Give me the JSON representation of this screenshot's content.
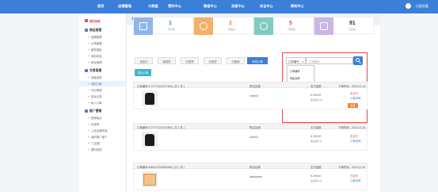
{
  "topnav": {
    "items": [
      "首页",
      "店铺管理",
      "大数据",
      "预约中心",
      "微信中心",
      "消息中心",
      "安全中心",
      "帮助中心"
    ],
    "user": "小甜欣喜"
  },
  "sidebar": {
    "home": "我的商城",
    "sections": [
      {
        "label": "商品管理",
        "items": [
          "品牌管理",
          "分类管理",
          "属性模板",
          "添加商品",
          "库存管理"
        ]
      },
      {
        "label": "交易管理",
        "items": [
          "佣金结算",
          "我的订单",
          "评价管理",
          "投诉记录",
          "私人订单"
        ]
      },
      {
        "label": "推广营销",
        "items": [
          "推荐组合",
          "优惠券",
          "入驻店铺商城",
          "我的推广客户",
          "广告推广",
          "限时抢购"
        ]
      }
    ]
  },
  "main": {
    "title": "我的订单",
    "stats": [
      {
        "value": "1",
        "caption": "待付款",
        "color": "#3b7fd9"
      },
      {
        "value": "2",
        "caption": "待发货",
        "color": "#f08a2b"
      },
      {
        "value": "5",
        "caption": "待收货",
        "color": "#e24a4a"
      },
      {
        "value": "91",
        "caption": "已完成",
        "color": "#333333"
      }
    ],
    "tabs": [
      "未支付",
      "待发货",
      "已发货",
      "已收货",
      "已取消",
      "所有订单"
    ],
    "active_tab": "所有订单",
    "search": {
      "select_value": "订单编号",
      "placeholder": "订单编号"
    },
    "dropdown_options": [
      "订单编号",
      "商品名称",
      "收货姓名",
      "下单时间"
    ],
    "batch_button": "导出订单",
    "col_headers": {
      "shop": "购买店铺",
      "total": "支付金额"
    },
    "orders": [
      {
        "order_no": "订单编号:4777771102077518 ( 共 1 件 )",
        "time": "下单时间：2023-12-14",
        "buyer": "chen51",
        "price": "¥ 203.00",
        "shipping": "含运费0.00",
        "status1": "未支付",
        "status2": "订单详情",
        "action": "发货",
        "img": "bag"
      },
      {
        "order_no": "订单编号:4777771122470652 ( 共 1 件 )",
        "time": "下单时间：2023-12-14",
        "buyer": "chen51",
        "price": "¥ 203.00",
        "shipping": "含运费0.00",
        "status1": "未支付",
        "status2": "订单详情",
        "action": "",
        "img": "bag"
      },
      {
        "order_no": "订单编号:4560237502892552 ( 共 1 件 )",
        "time": "下单时间：2023-12-10",
        "buyer": "xiaobianre",
        "price": "¥ 199.00",
        "shipping": "含运费0.00",
        "status1": "已发货",
        "status2": "订单详情",
        "action": "",
        "img": "cup"
      }
    ]
  }
}
